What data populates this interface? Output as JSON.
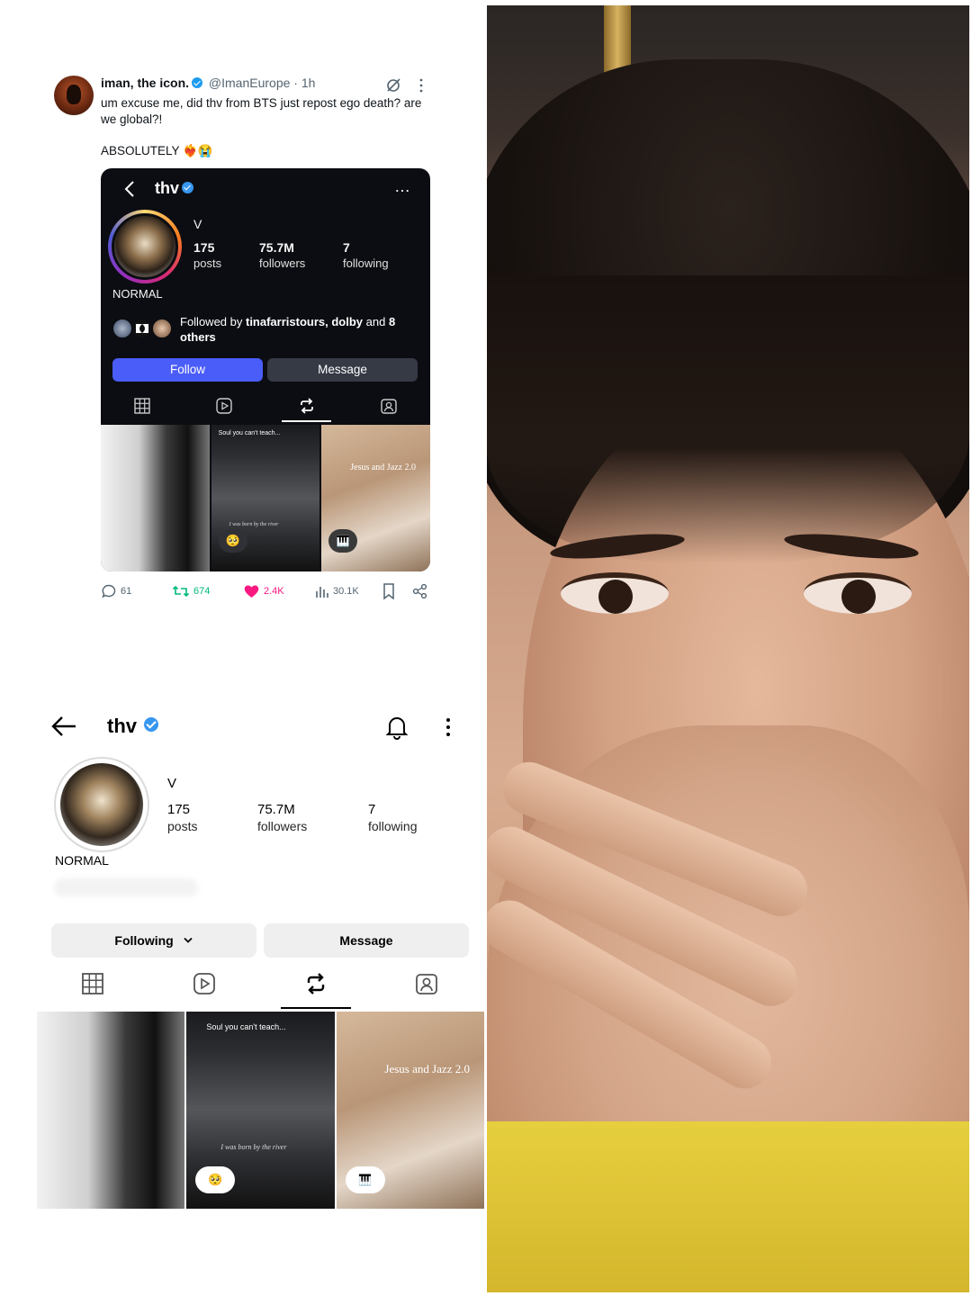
{
  "tweet": {
    "display_name": "iman, the icon.",
    "handle": "@ImanEurope",
    "separator": "·",
    "time": "1h",
    "text": "um excuse me, did thv from BTS just repost ego death? are we global?!",
    "text2": "ABSOLUTELY ❤️‍🔥😭",
    "actions": {
      "replies": "61",
      "reposts": "674",
      "likes": "2.4K",
      "views": "30.1K"
    },
    "colors": {
      "verified": "#1d9bf0",
      "repost": "#00ba7c",
      "like": "#f91880",
      "muted": "#536471"
    }
  },
  "embedded_profile": {
    "back_icon": "chevron-left-icon",
    "username": "thv",
    "more_label": "…",
    "name": "V",
    "stats": [
      {
        "num": "175",
        "label": "posts"
      },
      {
        "num": "75.7M",
        "label": "followers"
      },
      {
        "num": "7",
        "label": "following"
      }
    ],
    "bio": "NORMAL",
    "followed_by_prefix": "Followed by ",
    "followed_by_names": "tinafarristours, dolby",
    "followed_by_and": " and ",
    "followed_by_count": "8",
    "followed_by_suffix": "others",
    "follow_label": "Follow",
    "message_label": "Message",
    "colors": {
      "background": "#0b0d12",
      "follow": "#4a5df9",
      "message": "#363a45"
    }
  },
  "profile": {
    "username": "thv",
    "name": "V",
    "stats": [
      {
        "num": "175",
        "label": "posts"
      },
      {
        "num": "75.7M",
        "label": "followers"
      },
      {
        "num": "7",
        "label": "following"
      }
    ],
    "bio": "NORMAL",
    "following_label": "Following",
    "message_label": "Message"
  },
  "thumbnails": {
    "caption_soul": "Soul you can't teach...",
    "sub_river": "I was born by the river",
    "title_jesus": "Jesus and Jazz 2.0",
    "bubble_emoji": "🥺",
    "bubble_piano": "🎹"
  }
}
